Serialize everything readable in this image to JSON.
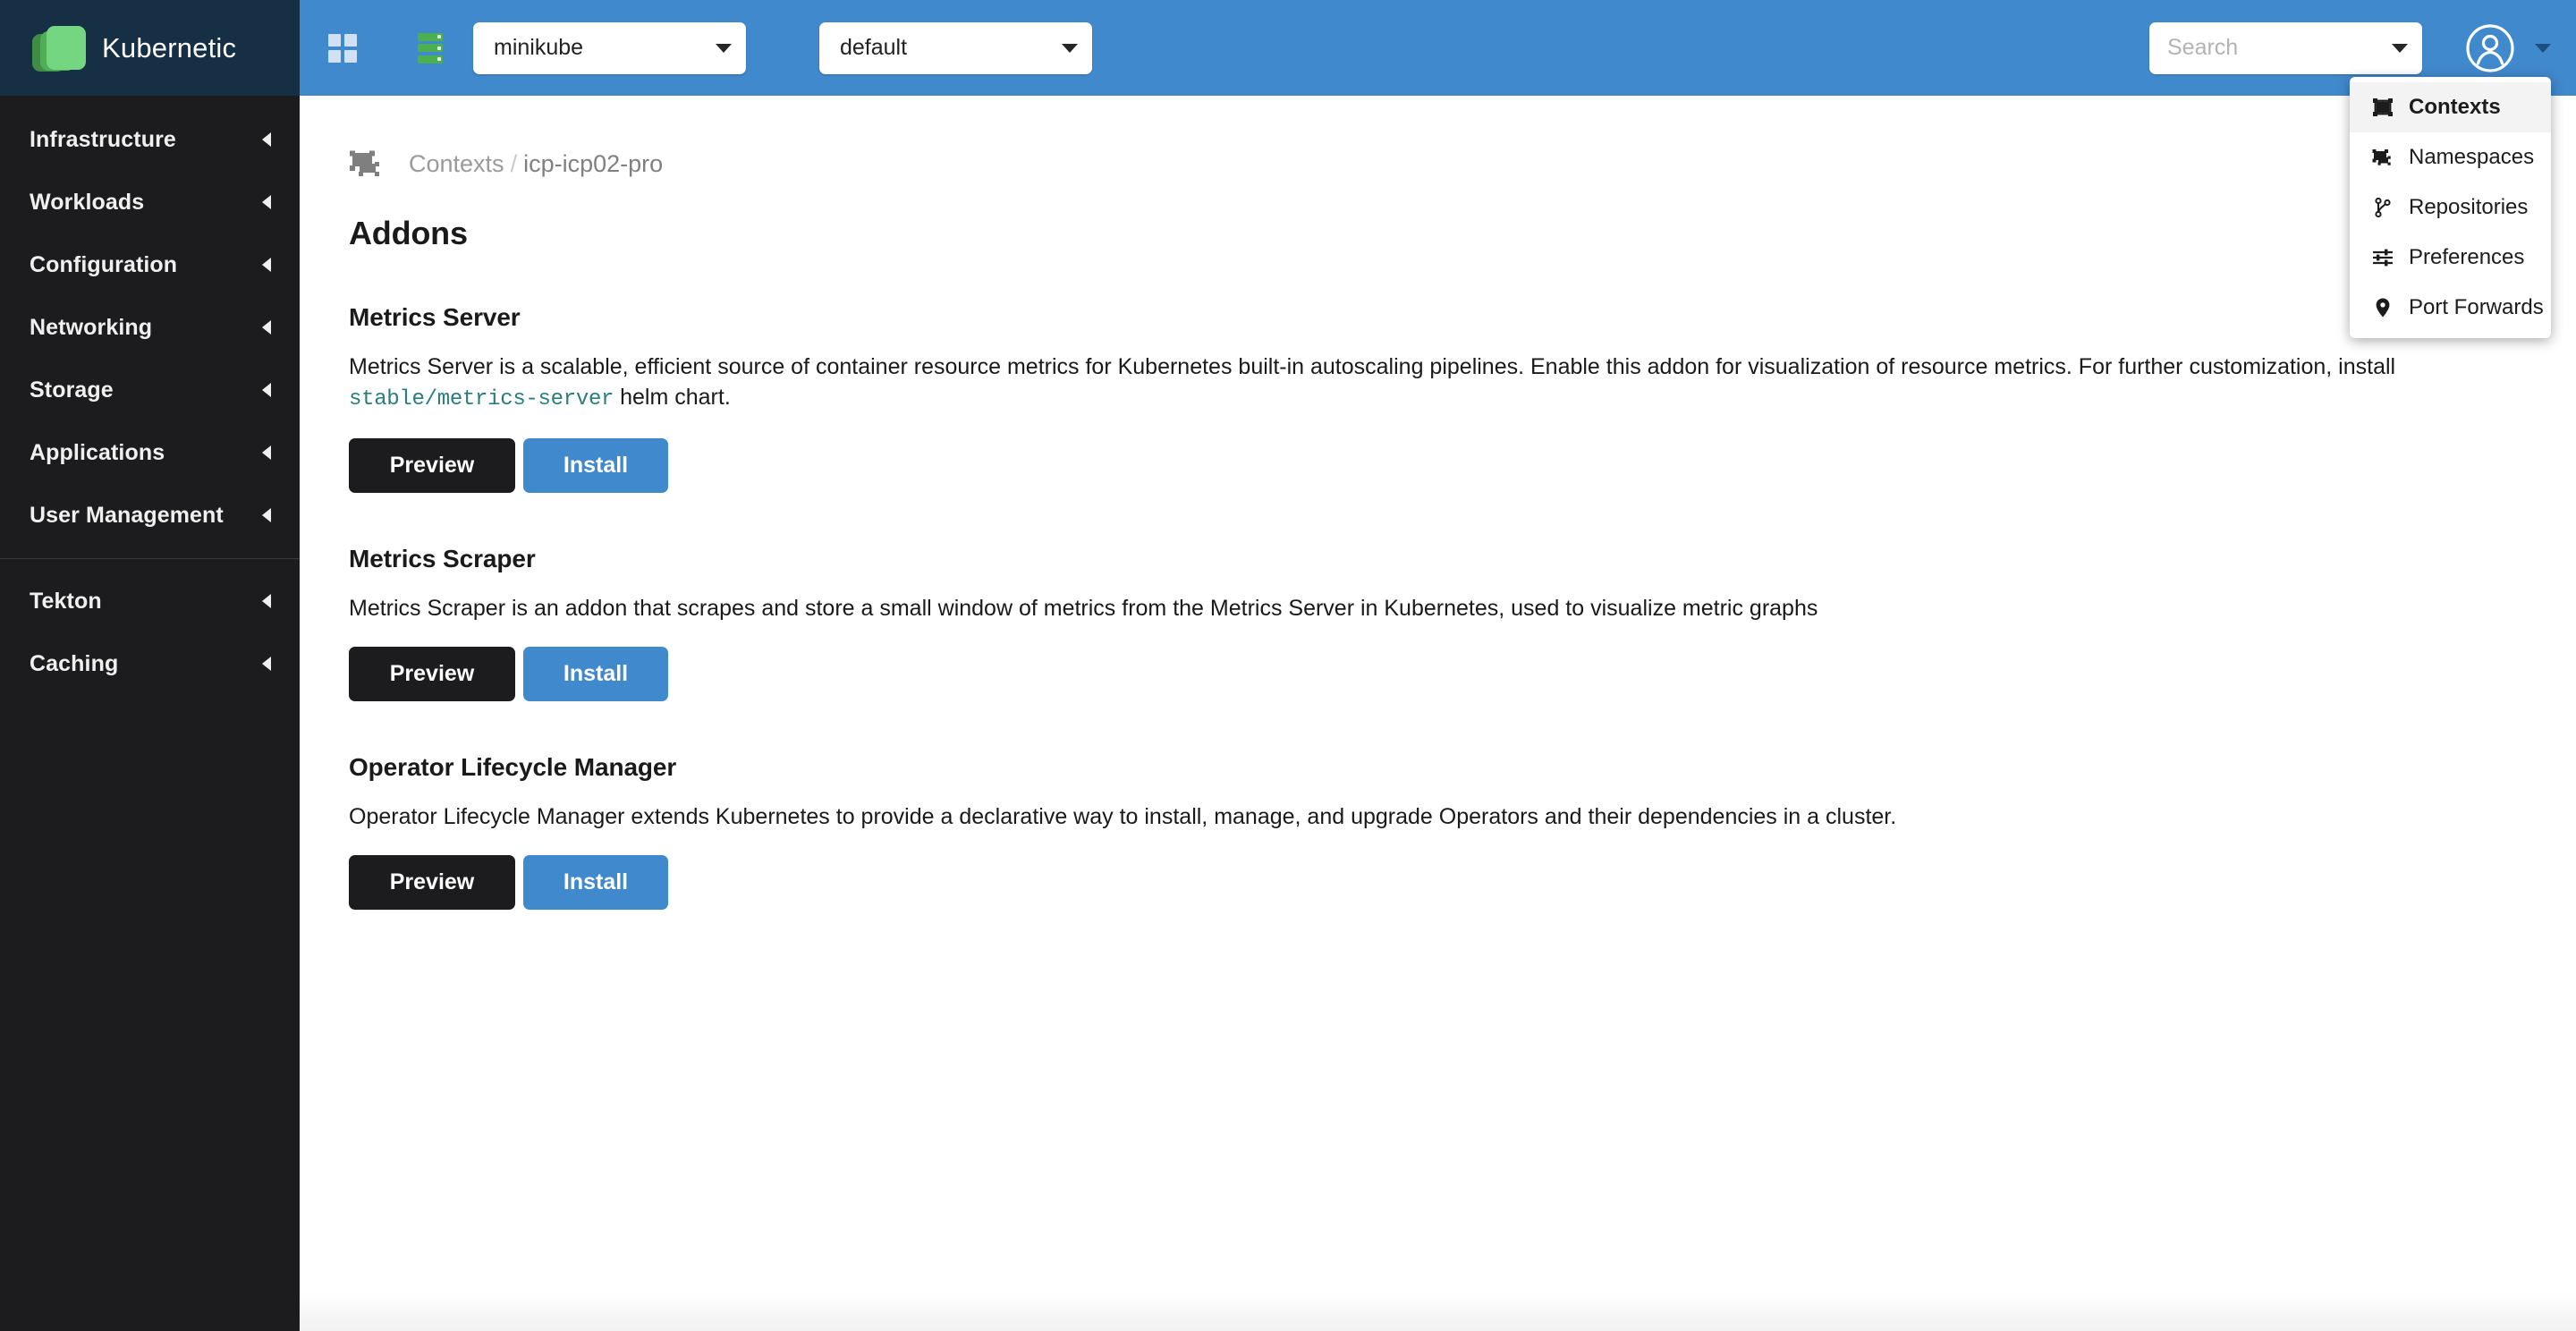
{
  "brand": {
    "name": "Kubernetic",
    "logo_icon": "kubernetic-logo-icon",
    "logo_colors": [
      "#3f8c46",
      "#4fae56",
      "#74d680"
    ]
  },
  "topbar": {
    "background_color": "#4189cd",
    "grid_icon": "grid-apps-icon",
    "server_icon": "server-stack-icon",
    "context_select": {
      "label": "minikube",
      "icon": "chevron-down-icon"
    },
    "namespace_select": {
      "label": "default",
      "icon": "chevron-down-icon"
    },
    "search": {
      "value": "",
      "placeholder": "Search",
      "icon": "chevron-down-icon"
    },
    "avatar_icon": "user-avatar-icon",
    "user_caret_icon": "chevron-down-icon"
  },
  "user_menu": {
    "items": [
      {
        "label": "Contexts",
        "icon": "context-frame-icon",
        "active": true
      },
      {
        "label": "Namespaces",
        "icon": "namespaces-icon",
        "active": false
      },
      {
        "label": "Repositories",
        "icon": "git-branch-icon",
        "active": false
      },
      {
        "label": "Preferences",
        "icon": "sliders-icon",
        "active": false
      },
      {
        "label": "Port Forwards",
        "icon": "location-pin-icon",
        "active": false
      }
    ]
  },
  "sidebar": {
    "background_color": "#1c1c1e",
    "groups": [
      {
        "items": [
          {
            "label": "Infrastructure",
            "arrow_icon": "chevron-left-icon"
          },
          {
            "label": "Workloads",
            "arrow_icon": "chevron-left-icon"
          },
          {
            "label": "Configuration",
            "arrow_icon": "chevron-left-icon"
          },
          {
            "label": "Networking",
            "arrow_icon": "chevron-left-icon"
          },
          {
            "label": "Storage",
            "arrow_icon": "chevron-left-icon"
          },
          {
            "label": "Applications",
            "arrow_icon": "chevron-left-icon"
          },
          {
            "label": "User Management",
            "arrow_icon": "chevron-left-icon"
          }
        ]
      },
      {
        "items": [
          {
            "label": "Tekton",
            "arrow_icon": "chevron-left-icon"
          },
          {
            "label": "Caching",
            "arrow_icon": "chevron-left-icon"
          }
        ]
      }
    ]
  },
  "main": {
    "breadcrumb": {
      "icon": "context-frame-icon",
      "root": "Contexts",
      "separator": "/",
      "current": "icp-icp02-pro"
    },
    "page_title": "Addons",
    "buttons": {
      "preview": "Preview",
      "install": "Install"
    },
    "addons": [
      {
        "title": "Metrics Server",
        "desc_before": "Metrics Server is a scalable, efficient source of container resource metrics for Kubernetes built-in autoscaling pipelines. Enable this addon for visualization of resource metrics. For further customization, install ",
        "code": "stable/metrics-server",
        "desc_after": " helm chart.",
        "preview_label": "Preview",
        "install_label": "Install"
      },
      {
        "title": "Metrics Scraper",
        "desc_before": "Metrics Scraper is an addon that scrapes and store a small window of metrics from the Metrics Server in Kubernetes, used to visualize metric graphs",
        "code": "",
        "desc_after": "",
        "preview_label": "Preview",
        "install_label": "Install"
      },
      {
        "title": "Operator Lifecycle Manager",
        "desc_before": "Operator Lifecycle Manager extends Kubernetes to provide a declarative way to install, manage, and upgrade Operators and their dependencies in a cluster.",
        "code": "",
        "desc_after": "",
        "preview_label": "Preview",
        "install_label": "Install"
      }
    ]
  },
  "colors": {
    "accent_blue": "#4189cd",
    "brand_dark": "#162f45",
    "sidebar_dark": "#1c1c1e",
    "code_teal": "#2a7d7d"
  }
}
